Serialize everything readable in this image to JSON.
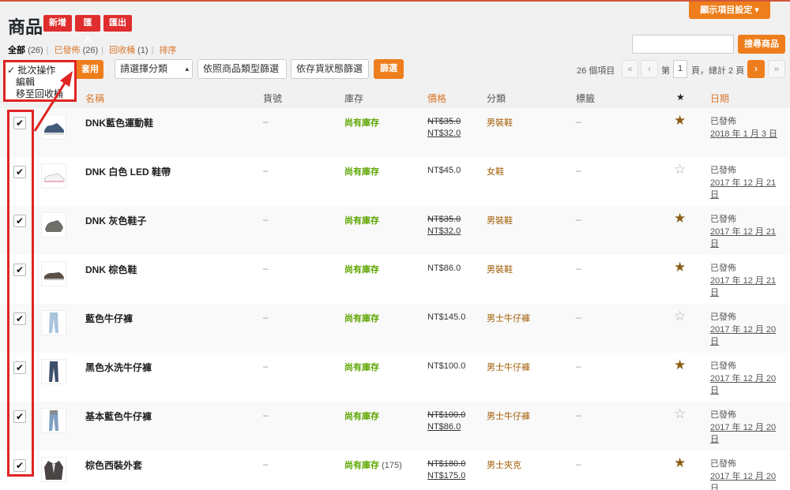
{
  "page": {
    "title": "商品",
    "add_label": "新增",
    "import_label": "匯入",
    "export_label": "匯出",
    "screen_options_label": "顯示項目設定 ▾"
  },
  "views": {
    "all_label": "全部",
    "all_count": "(26)",
    "published_label": "已發佈",
    "published_count": "(26)",
    "trash_label": "回收桶",
    "trash_count": "(1)",
    "sort_label": "排序"
  },
  "search": {
    "button_label": "搜尋商品",
    "value": ""
  },
  "bulk": {
    "selected": "✓ 批次操作",
    "options": [
      "編輯",
      "移至回收桶"
    ],
    "apply_label": "套用"
  },
  "filters": {
    "category": "請選擇分類",
    "type": "依照商品類型篩選",
    "stock": "依存貨狀態篩選",
    "filter_label": "篩選"
  },
  "pagination": {
    "items": "26 個項目",
    "first": "«",
    "prev": "‹",
    "page_prefix": "第",
    "current": "1",
    "page_suffix": "頁，總計 2 頁",
    "next": "›",
    "last": "»"
  },
  "columns": {
    "name": "名稱",
    "sku": "貨號",
    "stock": "庫存",
    "price": "價格",
    "category": "分類",
    "tags": "標籤",
    "featured": "★",
    "date": "日期"
  },
  "products": [
    {
      "name": "DNK藍色運動鞋",
      "sku": "–",
      "stock": "尚有庫存",
      "qty": "",
      "old_price": "NT$35.0",
      "price": "NT$32.0",
      "category": "男裝鞋",
      "tags": "–",
      "featured": "★",
      "status": "已發佈",
      "date": "2018 年 1 月 3 日",
      "thumb": "sneaker-blue"
    },
    {
      "name": "DNK 白色 LED 鞋帶",
      "sku": "–",
      "stock": "尚有庫存",
      "qty": "",
      "old_price": "",
      "price": "NT$45.0",
      "category": "女鞋",
      "tags": "–",
      "featured": "☆",
      "status": "已發佈",
      "date": "2017 年 12 月 21 日",
      "thumb": "sneaker-white"
    },
    {
      "name": "DNK 灰色鞋子",
      "sku": "–",
      "stock": "尚有庫存",
      "qty": "",
      "old_price": "NT$35.0",
      "price": "NT$32.0",
      "category": "男裝鞋",
      "tags": "–",
      "featured": "★",
      "status": "已發佈",
      "date": "2017 年 12 月 21 日",
      "thumb": "shoe-grey"
    },
    {
      "name": "DNK 棕色鞋",
      "sku": "–",
      "stock": "尚有庫存",
      "qty": "",
      "old_price": "",
      "price": "NT$86.0",
      "category": "男裝鞋",
      "tags": "–",
      "featured": "★",
      "status": "已發佈",
      "date": "2017 年 12 月 21 日",
      "thumb": "shoe-brown"
    },
    {
      "name": "藍色牛仔褲",
      "sku": "–",
      "stock": "尚有庫存",
      "qty": "",
      "old_price": "",
      "price": "NT$145.0",
      "category": "男士牛仔褲",
      "tags": "–",
      "featured": "☆",
      "status": "已發佈",
      "date": "2017 年 12 月 20 日",
      "thumb": "jeans-light"
    },
    {
      "name": "黑色水洗牛仔褲",
      "sku": "–",
      "stock": "尚有庫存",
      "qty": "",
      "old_price": "",
      "price": "NT$100.0",
      "category": "男士牛仔褲",
      "tags": "–",
      "featured": "★",
      "status": "已發佈",
      "date": "2017 年 12 月 20 日",
      "thumb": "jeans-dark"
    },
    {
      "name": "基本藍色牛仔褲",
      "sku": "–",
      "stock": "尚有庫存",
      "qty": "",
      "old_price": "NT$100.0",
      "price": "NT$86.0",
      "category": "男士牛仔褲",
      "tags": "–",
      "featured": "☆",
      "status": "已發佈",
      "date": "2017 年 12 月 20 日",
      "thumb": "jeans-blue"
    },
    {
      "name": "棕色西裝外套",
      "sku": "–",
      "stock": "尚有庫存",
      "qty": "(175)",
      "old_price": "NT$180.0",
      "price": "NT$175.0",
      "category": "男士夾克",
      "tags": "–",
      "featured": "★",
      "status": "已發佈",
      "date": "2017 年 12 月 20 日",
      "thumb": "jacket"
    }
  ],
  "colors": {
    "accent": "#ee7e1c",
    "danger": "#e02d2d",
    "link": "#d9772c",
    "in_stock": "#5ea600",
    "star": "#8b5e17"
  }
}
